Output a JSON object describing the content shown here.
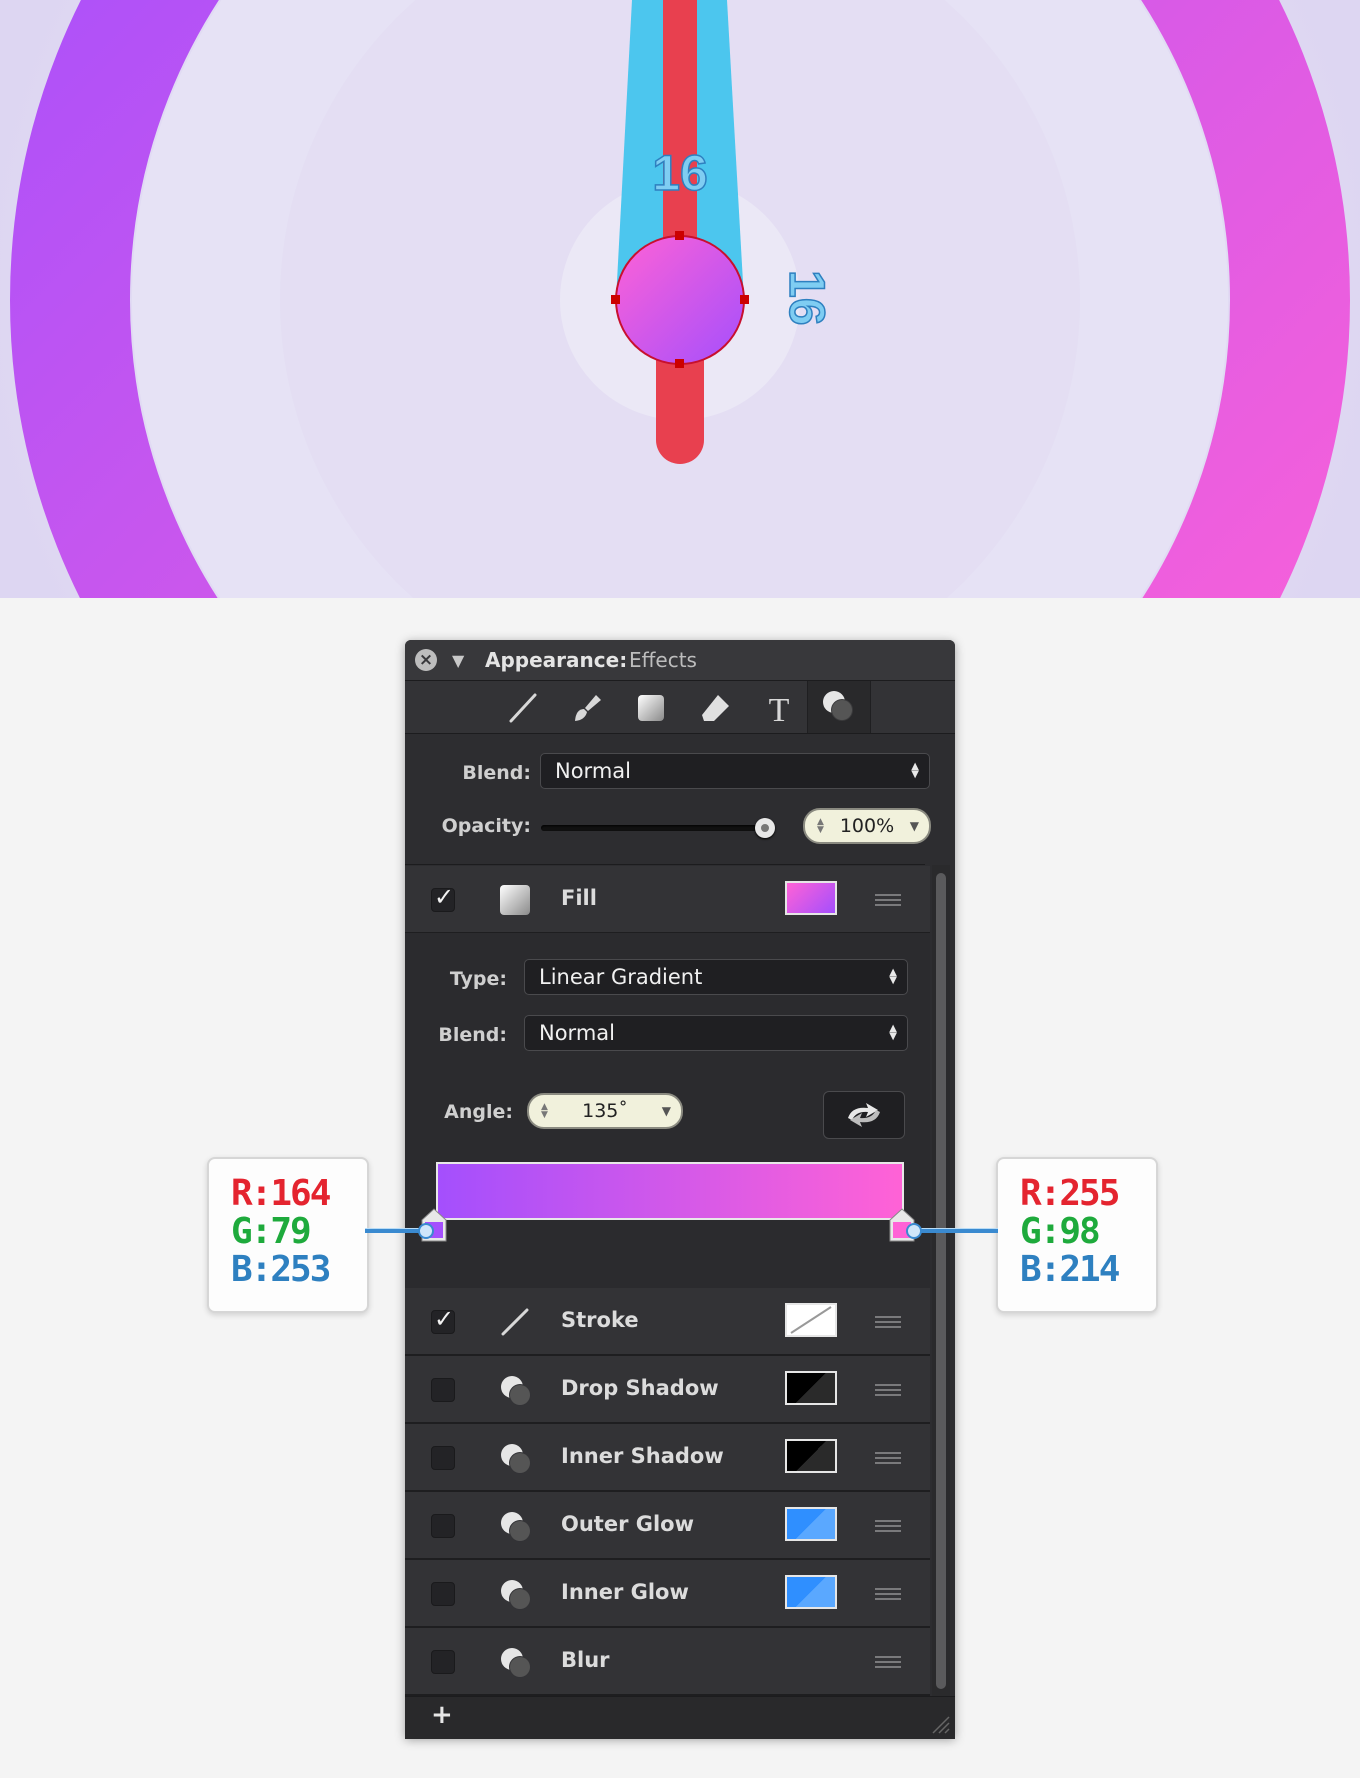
{
  "canvas": {
    "measure_top": "16",
    "measure_right": "16"
  },
  "panel": {
    "title": "Appearance:",
    "subtitle": "Effects",
    "blend_label": "Blend:",
    "blend_value": "Normal",
    "opacity_label": "Opacity:",
    "opacity_value": "100%",
    "opacity_fraction": 1.0,
    "tools": [
      "stroke-tool-icon",
      "brush-tool-icon",
      "fill-tool-icon",
      "eraser-tool-icon",
      "text-tool-icon",
      "effects-tool-icon"
    ],
    "fill": {
      "label": "Fill",
      "checked": true,
      "swatch_colors": [
        "#a44ffd",
        "#ff62d6"
      ],
      "type_label": "Type:",
      "type_value": "Linear Gradient",
      "blend_label": "Blend:",
      "blend_value": "Normal",
      "angle_label": "Angle:",
      "angle_value": "135˚",
      "gradient_start": "#a44ffd",
      "gradient_end": "#ff62d6"
    },
    "effects": [
      {
        "label": "Stroke",
        "checked": true,
        "swatch": "stroke-none"
      },
      {
        "label": "Drop Shadow",
        "checked": false,
        "swatch": "#000000"
      },
      {
        "label": "Inner Shadow",
        "checked": false,
        "swatch": "#000000"
      },
      {
        "label": "Outer Glow",
        "checked": false,
        "swatch": "#2f8fff"
      },
      {
        "label": "Inner Glow",
        "checked": false,
        "swatch": "#2f8fff"
      },
      {
        "label": "Blur",
        "checked": false,
        "swatch": null
      }
    ],
    "add_label": "+"
  },
  "callouts": {
    "left": {
      "r": "R:164",
      "g": "G:79",
      "b": "B:253"
    },
    "right": {
      "r": "R:255",
      "g": "G:98",
      "b": "B:214"
    }
  },
  "colors": {
    "panel_bg": "#2d2d30",
    "ring_left": "#a44ffd",
    "ring_right": "#ff62d6",
    "needle_blue": "#4cc6ee",
    "needle_red": "#e8404f"
  }
}
